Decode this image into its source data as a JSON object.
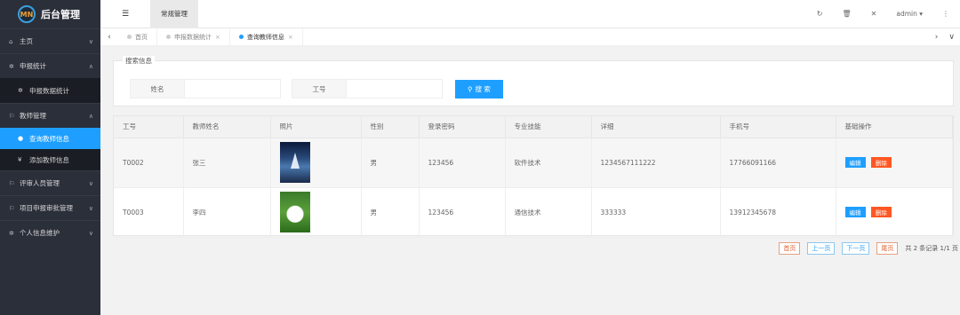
{
  "brand": {
    "logo_text": "MN",
    "title": "后台管理"
  },
  "sidebar": {
    "items": [
      {
        "icon": "home-icon",
        "glyph": "⌂",
        "label": "主页",
        "caret": "∨"
      },
      {
        "icon": "gear-icon",
        "glyph": "✲",
        "label": "申报统计",
        "caret": "∧"
      },
      {
        "icon": "flag-icon",
        "glyph": "⚐",
        "label": "教师管理",
        "caret": "∧"
      },
      {
        "icon": "flag-icon",
        "glyph": "⚐",
        "label": "评审人员管理",
        "caret": "∨"
      },
      {
        "icon": "flag-icon",
        "glyph": "⚐",
        "label": "项目申报审批管理",
        "caret": "∨"
      },
      {
        "icon": "gear-icon",
        "glyph": "✲",
        "label": "个人信息维护",
        "caret": "∨"
      }
    ],
    "sub_stats": [
      {
        "glyph": "✲",
        "label": "申报数据统计"
      }
    ],
    "sub_teacher": [
      {
        "glyph": "●",
        "label": "查询教师信息"
      },
      {
        "glyph": "¥",
        "label": "添加教师信息"
      }
    ]
  },
  "header": {
    "menu_glyph": "☰",
    "top_tab": "常规管理",
    "refresh_glyph": "↻",
    "clear_glyph": "🗑",
    "fullscreen_glyph": "✕",
    "user": "admin ▾",
    "more_glyph": "⋮"
  },
  "tabbar": {
    "left_arrow": "‹",
    "tabs": [
      {
        "label": "首页",
        "close": ""
      },
      {
        "label": "申报数据统计",
        "close": "×"
      },
      {
        "label": "查询教师信息",
        "close": "×"
      }
    ],
    "right_arrow": "›",
    "down_arrow": "∨"
  },
  "search": {
    "legend": "搜索信息",
    "name_label": "姓名",
    "name_value": "",
    "id_label": "工号",
    "id_value": "",
    "button_icon": "⚲",
    "button_label": "搜 索"
  },
  "table": {
    "headers": [
      "工号",
      "教师姓名",
      "照片",
      "性别",
      "登录密码",
      "专业技能",
      "详细",
      "手机号",
      "基础操作"
    ],
    "rows": [
      {
        "id": "T0002",
        "name": "张三",
        "photo": "boat",
        "gender": "男",
        "password": "123456",
        "skill": "软件技术",
        "detail": "1234567111222",
        "phone": "17766091166",
        "edit": "编辑",
        "delete": "删除"
      },
      {
        "id": "T0003",
        "name": "李四",
        "photo": "rabbit",
        "gender": "男",
        "password": "123456",
        "skill": "通信技术",
        "detail": "333333",
        "phone": "13912345678",
        "edit": "编辑",
        "delete": "删除"
      }
    ]
  },
  "pager": {
    "first": "首页",
    "prev": "上一页",
    "next": "下一页",
    "last": "尾页",
    "info": "共 2 条记录 1/1 页"
  }
}
